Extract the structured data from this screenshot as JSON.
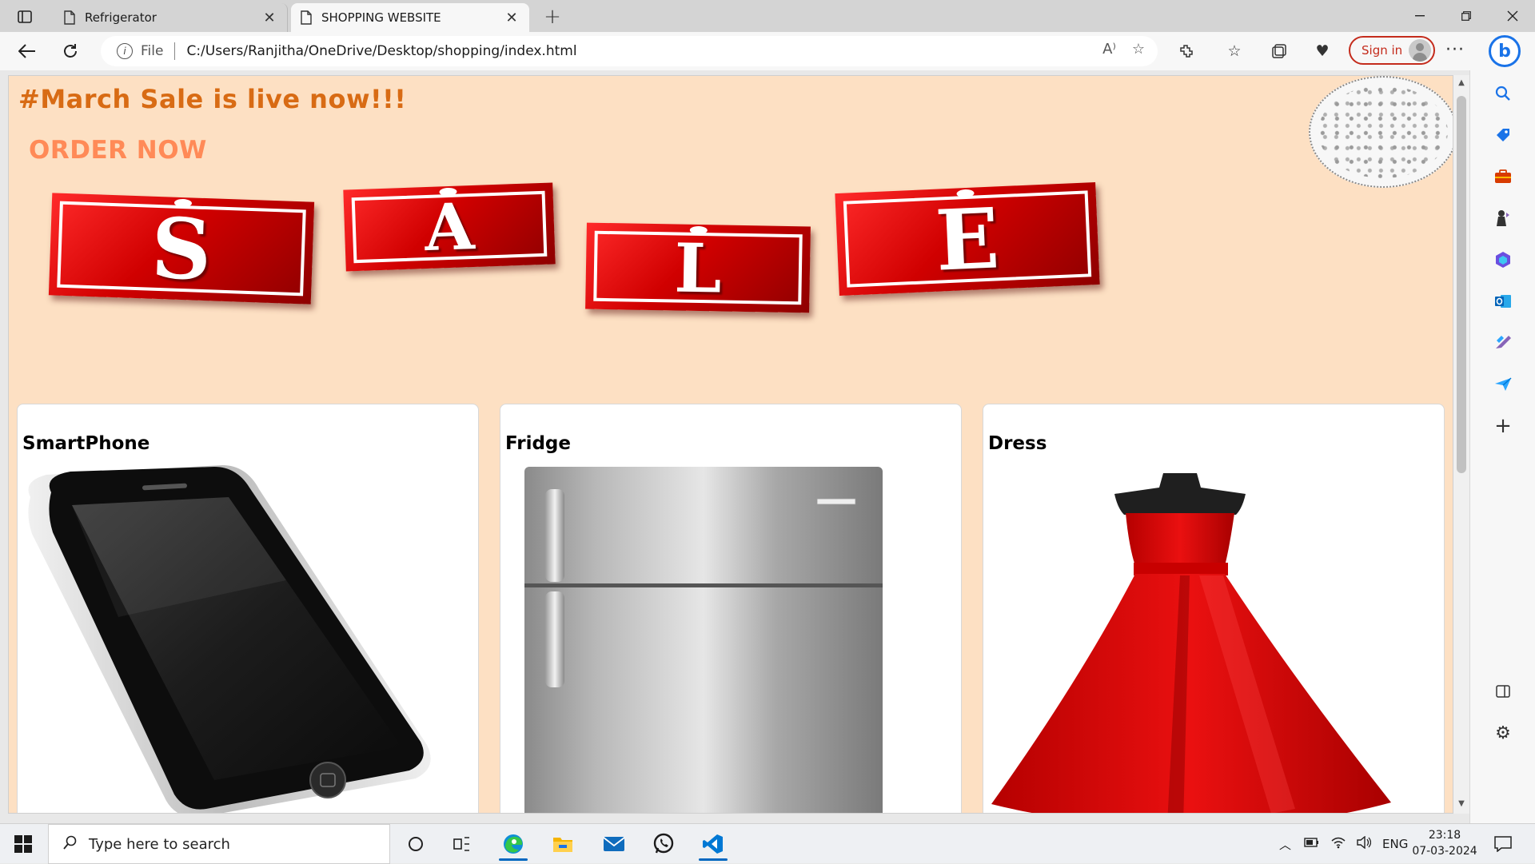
{
  "browser": {
    "tabs": [
      {
        "title": "Refrigerator",
        "active": false
      },
      {
        "title": "SHOPPING WEBSITE",
        "active": true
      }
    ],
    "address": {
      "scheme_label": "File",
      "url": "C:/Users/Ranjitha/OneDrive/Desktop/shopping/index.html"
    },
    "signin_label": "Sign in",
    "accent": "#c42b1c"
  },
  "page": {
    "headline": "#March Sale is live now!!!",
    "order_link": "ORDER NOW",
    "sale_letters": [
      "S",
      "A",
      "L",
      "E"
    ],
    "colors": {
      "background": "#fde0c3",
      "headline": "#d86b14",
      "order_link": "#ff8a57",
      "tile_red": "#d00000"
    },
    "products": [
      {
        "name": "SmartPhone",
        "image": "smartphone-image"
      },
      {
        "name": "Fridge",
        "image": "fridge-image"
      },
      {
        "name": "Dress",
        "image": "dress-image"
      }
    ]
  },
  "taskbar": {
    "search_placeholder": "Type here to search",
    "language": "ENG",
    "time": "23:18",
    "date": "07-03-2024"
  }
}
